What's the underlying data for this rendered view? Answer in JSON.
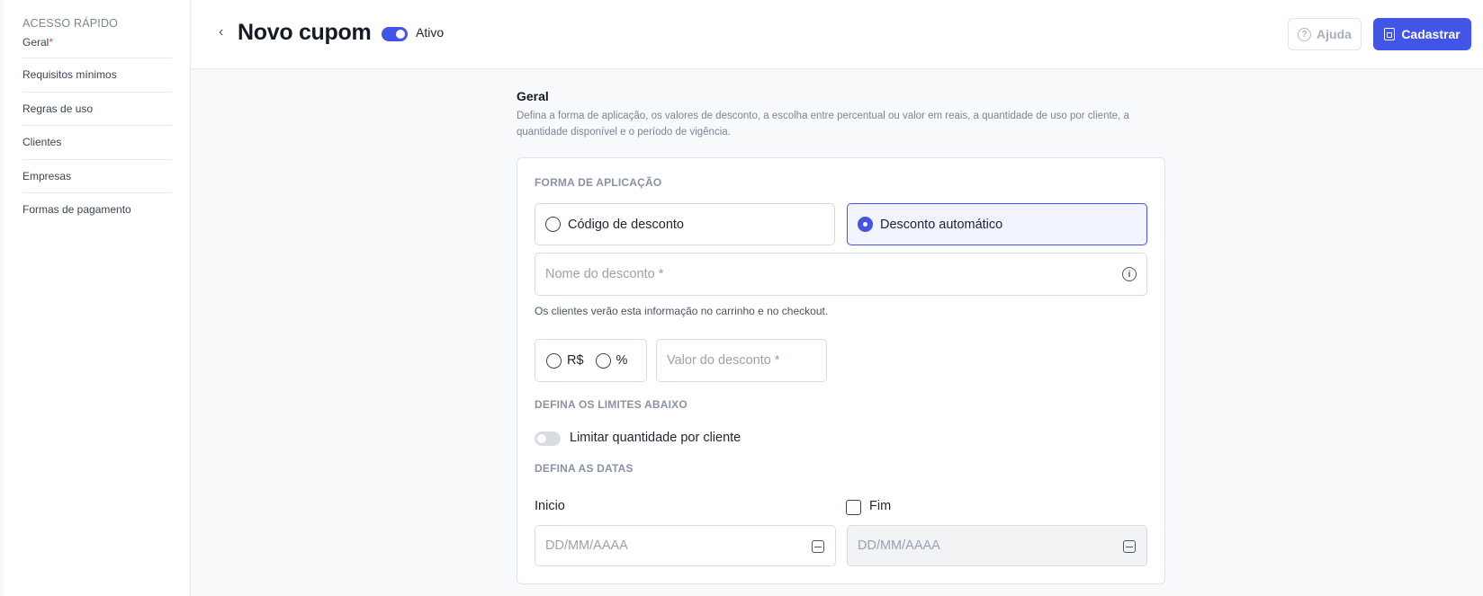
{
  "sidebar": {
    "title": "ACESSO RÁPIDO",
    "items": [
      {
        "label": "Geral",
        "required_mark": "*"
      },
      {
        "label": "Requisitos mínimos"
      },
      {
        "label": "Regras de uso"
      },
      {
        "label": "Clientes"
      },
      {
        "label": "Empresas"
      },
      {
        "label": "Formas de pagamento"
      }
    ]
  },
  "header": {
    "back_icon": "chevron-left-icon",
    "back_glyph": "‹",
    "title": "Novo cupom",
    "status_label": "Ativo",
    "status_on": true,
    "help_label": "Ajuda",
    "help_glyph": "?",
    "save_label": "Cadastrar"
  },
  "section": {
    "title": "Geral",
    "description": "Defina a forma de aplicação, os valores de desconto, a escolha entre percentual ou valor em reais, a quantidade de uso por cliente, a quantidade disponível e o período de vigência."
  },
  "form": {
    "application_label": "FORMA DE APLICAÇÃO",
    "options": [
      {
        "label": "Código de desconto",
        "selected": false
      },
      {
        "label": "Desconto automático",
        "selected": true
      }
    ],
    "name_placeholder": "Nome do desconto *",
    "info_glyph": "i",
    "name_helper": "Os clientes verão esta informação no carrinho e no checkout.",
    "currency_options": [
      "R$",
      "%"
    ],
    "value_placeholder": "Valor do desconto *",
    "limits_label": "DEFINA OS LIMITES ABAIXO",
    "limit_toggle_label": "Limitar quantidade por cliente",
    "dates_label": "DEFINA AS DATAS",
    "start_label": "Inicio",
    "end_label": "Fim",
    "date_placeholder": "DD/MM/AAAA"
  },
  "colors": {
    "accent": "#4355e6",
    "required": "#e5484d"
  }
}
